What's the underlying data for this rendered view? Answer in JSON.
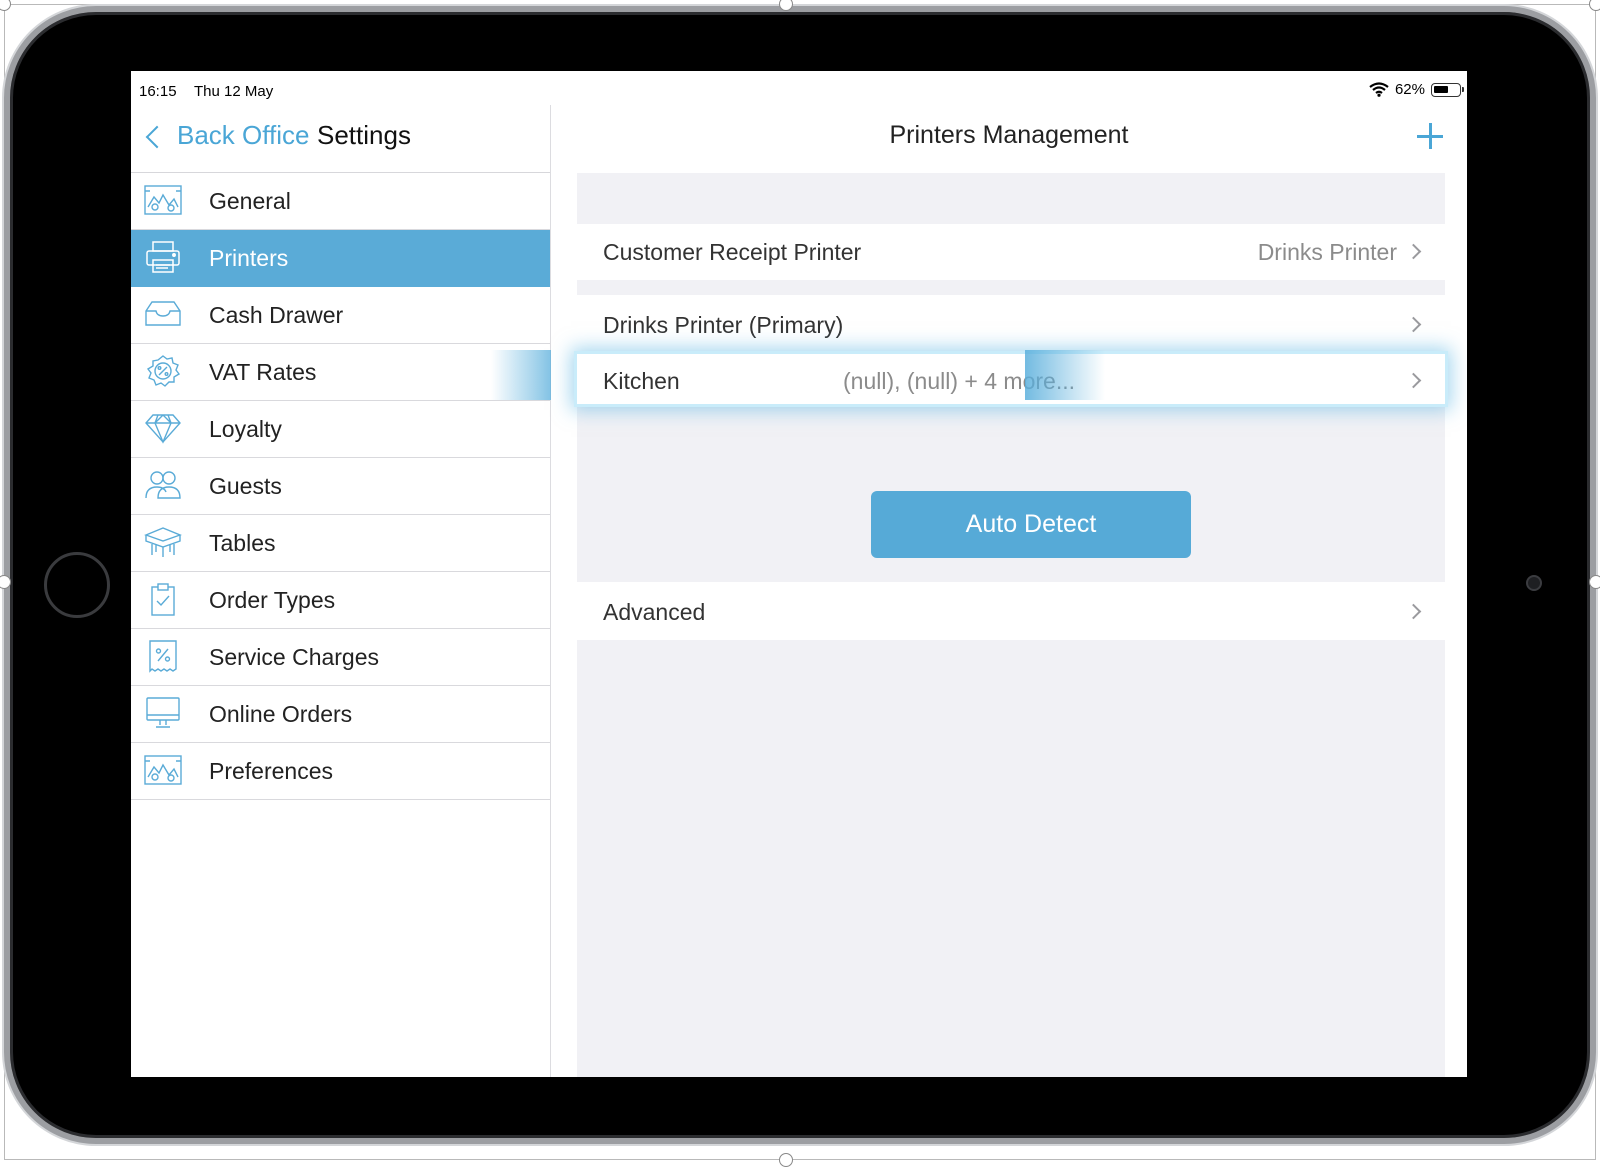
{
  "status_bar": {
    "time": "16:15",
    "date": "Thu 12 May",
    "battery": "62%",
    "battery_level": 0.62
  },
  "sidebar": {
    "back_label": "Back Office",
    "title": "Settings",
    "items": [
      {
        "label": "General",
        "icon": "general-icon",
        "active": false
      },
      {
        "label": "Printers",
        "icon": "printer-icon",
        "active": true
      },
      {
        "label": "Cash Drawer",
        "icon": "cash-drawer-icon",
        "active": false
      },
      {
        "label": "VAT Rates",
        "icon": "percent-gear-icon",
        "active": false
      },
      {
        "label": "Loyalty",
        "icon": "diamond-icon",
        "active": false
      },
      {
        "label": "Guests",
        "icon": "guests-icon",
        "active": false
      },
      {
        "label": "Tables",
        "icon": "table-icon",
        "active": false
      },
      {
        "label": "Order Types",
        "icon": "clipboard-check-icon",
        "active": false
      },
      {
        "label": "Service Charges",
        "icon": "receipt-percent-icon",
        "active": false
      },
      {
        "label": "Online Orders",
        "icon": "monitor-icon",
        "active": false
      },
      {
        "label": "Preferences",
        "icon": "preferences-icon",
        "active": false
      }
    ]
  },
  "main": {
    "title": "Printers Management",
    "add_icon": "plus-icon",
    "rows": {
      "customer_receipt": {
        "title": "Customer Receipt Printer",
        "value": "Drinks Printer"
      },
      "drinks": {
        "title": "Drinks Printer (Primary)"
      },
      "kitchen": {
        "title": "Kitchen",
        "value": "(null), (null) + 4 more..."
      }
    },
    "auto_detect_label": "Auto Detect",
    "advanced_label": "Advanced"
  },
  "colors": {
    "accent": "#4aa6d6",
    "active_row": "#5aabd7",
    "panel_bg": "#f1f1f5"
  }
}
